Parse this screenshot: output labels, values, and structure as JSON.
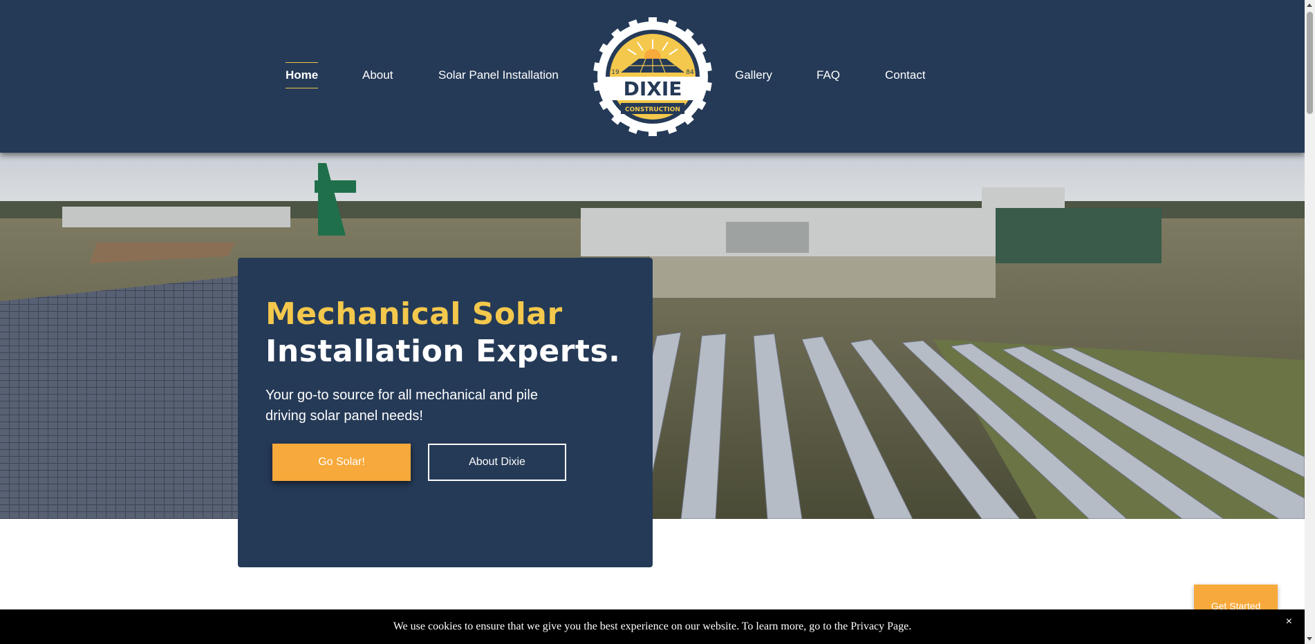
{
  "nav": {
    "items": [
      {
        "label": "Home",
        "active": true
      },
      {
        "label": "About",
        "active": false
      },
      {
        "label": "Solar Panel Installation",
        "active": false
      },
      {
        "label": "Gallery",
        "active": false
      },
      {
        "label": "FAQ",
        "active": false
      },
      {
        "label": "Contact",
        "active": false
      }
    ]
  },
  "logo": {
    "name": "DIXIE",
    "sub": "CONSTRUCTION",
    "year_left": "19",
    "year_right": "84"
  },
  "hero": {
    "title_accent": "Mechanical Solar",
    "title_main": "Installation Experts.",
    "subtitle": "Your go-to source for all mechanical and pile driving solar panel needs!",
    "primary_button": "Go Solar!",
    "secondary_button": "About Dixie"
  },
  "floating_button": "Get Started",
  "cookie": {
    "message": "We use cookies to ensure that we give you the best experience on our website. To learn more, go to the Privacy Page.",
    "close": "×"
  },
  "colors": {
    "navy": "#253a57",
    "accent_yellow": "#f4c84c",
    "button_orange": "#f7a93b"
  }
}
